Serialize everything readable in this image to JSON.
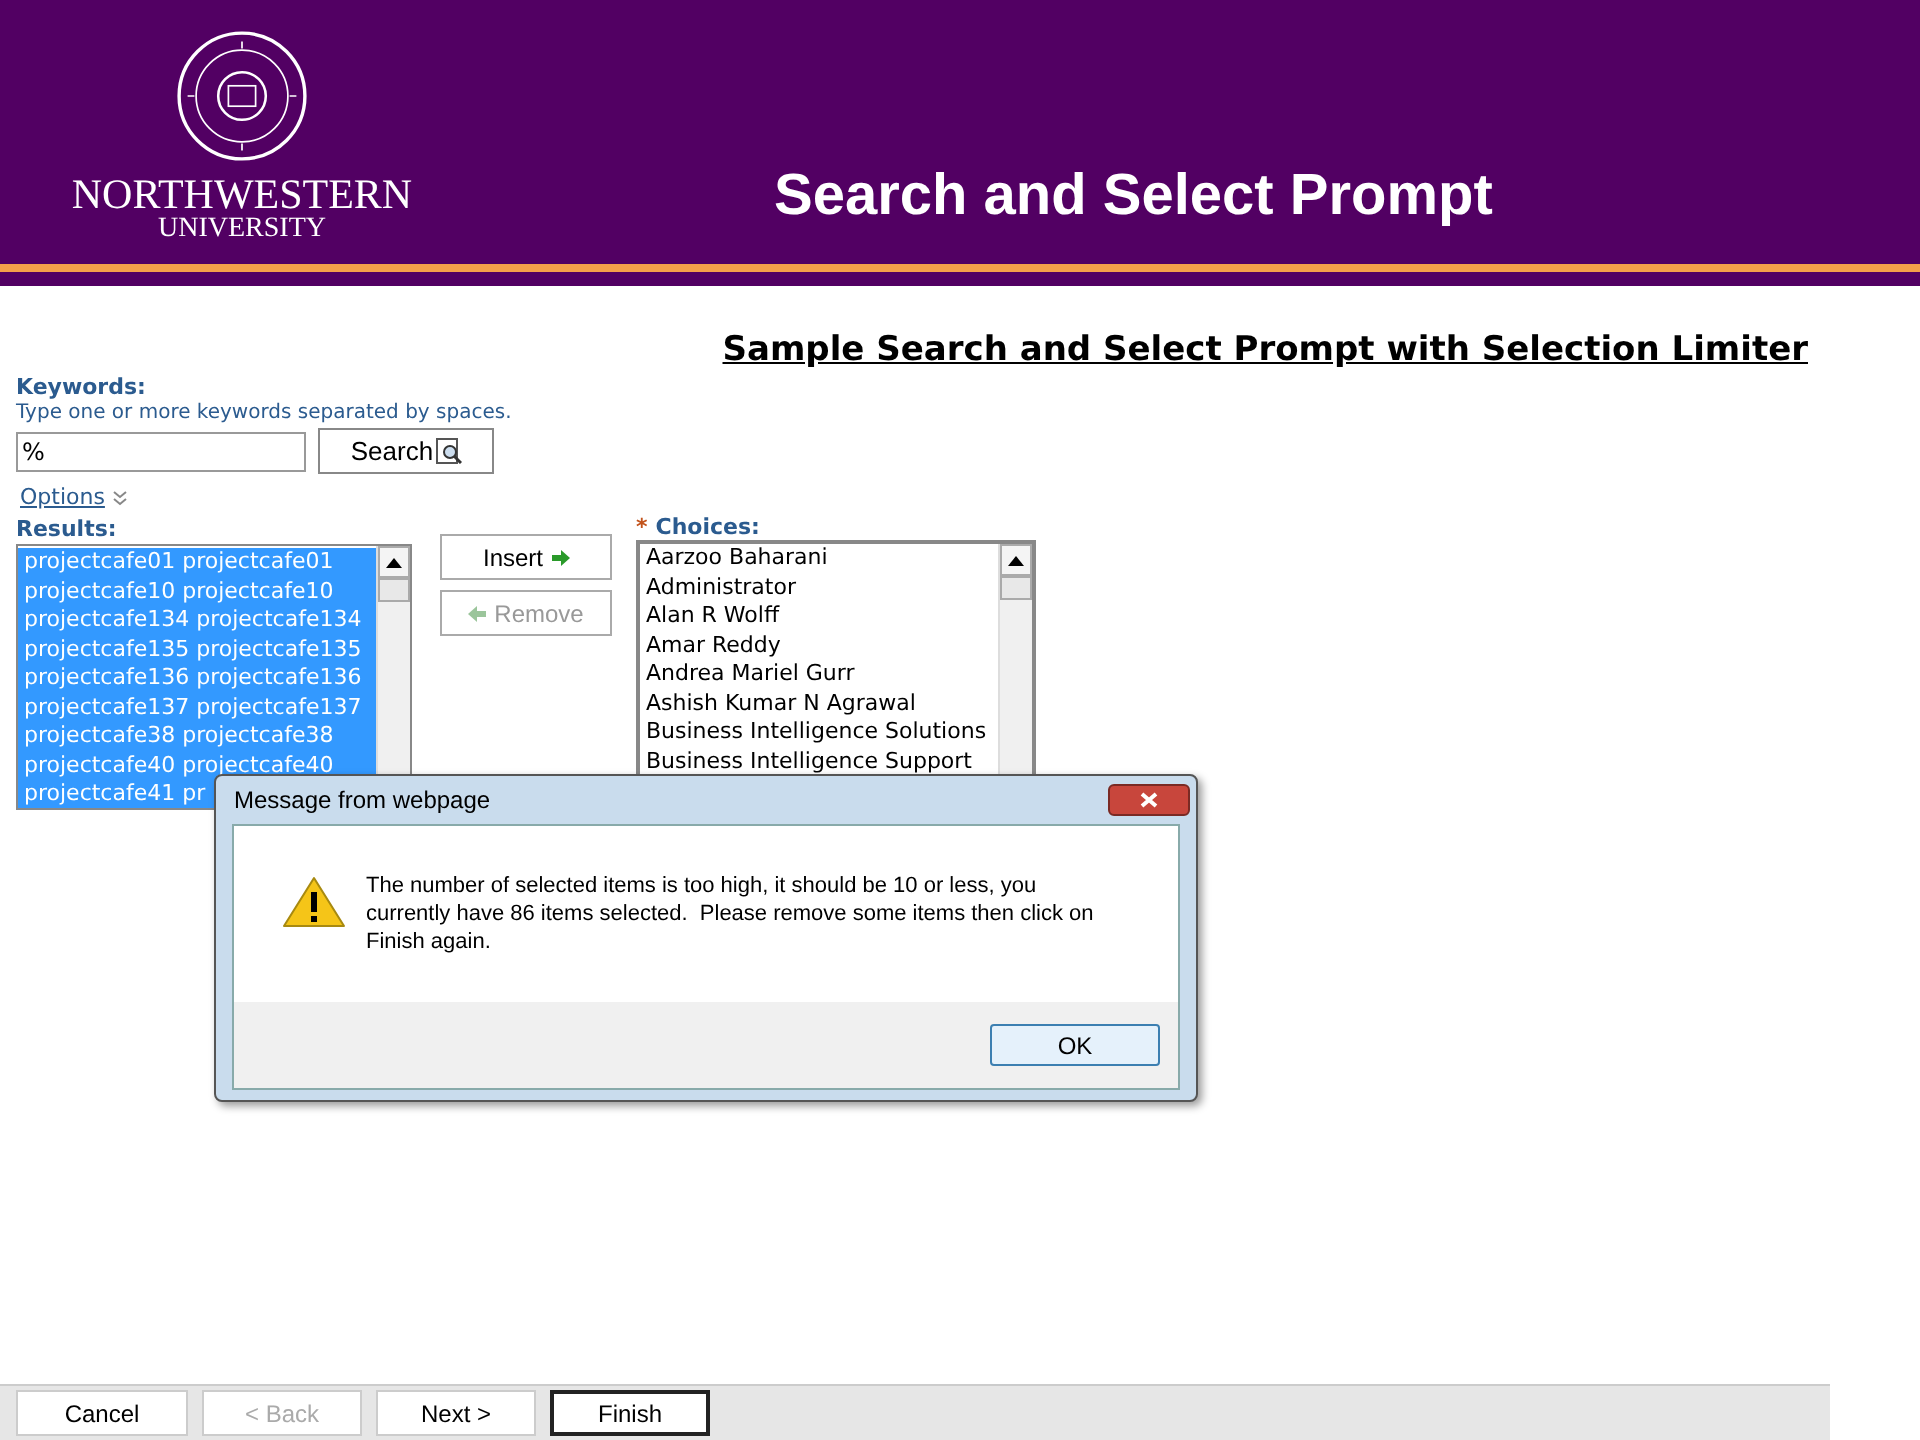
{
  "header": {
    "wordmark": "NORTHWESTERN",
    "wordmark_sub": "UNIVERSITY",
    "title": "Search and Select Prompt"
  },
  "page_title": "Sample Search and Select Prompt with Selection Limiter",
  "keywords": {
    "label": "Keywords:",
    "hint": "Type one or more keywords separated by spaces.",
    "value": "%",
    "search_button": "Search"
  },
  "options_link": "Options",
  "results": {
    "label": "Results:",
    "items": [
      {
        "text": "projectcafe01 projectcafe01",
        "selected": true
      },
      {
        "text": "projectcafe10 projectcafe10",
        "selected": true
      },
      {
        "text": "projectcafe134 projectcafe134",
        "selected": true
      },
      {
        "text": "projectcafe135 projectcafe135",
        "selected": true
      },
      {
        "text": "projectcafe136 projectcafe136",
        "selected": true
      },
      {
        "text": "projectcafe137 projectcafe137",
        "selected": true
      },
      {
        "text": "projectcafe38 projectcafe38",
        "selected": true
      },
      {
        "text": "projectcafe40 projectcafe40",
        "selected": true
      },
      {
        "text": "projectcafe41 pr",
        "selected": true
      }
    ]
  },
  "move_buttons": [
    {
      "label": "Insert",
      "kind": "insert",
      "disabled": false
    },
    {
      "label": "Remove",
      "kind": "remove",
      "disabled": true
    }
  ],
  "choices": {
    "required_mark": "*",
    "label": "Choices:",
    "items": [
      "Aarzoo Baharani",
      "Administrator",
      "Alan R Wolff",
      "Amar Reddy",
      "Andrea Mariel Gurr",
      "Ashish Kumar N Agrawal",
      "Business Intelligence Solutions",
      "Business Intelligence Support"
    ]
  },
  "dialog": {
    "title": "Message from webpage",
    "message": "The number of selected items is too high, it should be 10 or less, you currently have 86 items selected.  Please remove some items then click on Finish again.",
    "ok_button": "OK"
  },
  "footer_buttons": [
    {
      "label": "Cancel",
      "disabled": false,
      "default": false
    },
    {
      "label": "< Back",
      "disabled": true,
      "default": false
    },
    {
      "label": "Next >",
      "disabled": false,
      "default": false
    },
    {
      "label": "Finish",
      "disabled": false,
      "default": true
    }
  ]
}
